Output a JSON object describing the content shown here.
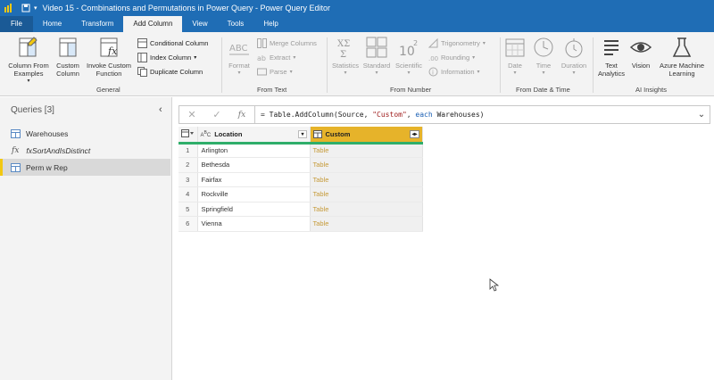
{
  "window": {
    "title": "Video 15 - Combinations and Permutations in Power Query - Power Query Editor"
  },
  "tabs": [
    {
      "label": "File"
    },
    {
      "label": "Home"
    },
    {
      "label": "Transform"
    },
    {
      "label": "Add Column"
    },
    {
      "label": "View"
    },
    {
      "label": "Tools"
    },
    {
      "label": "Help"
    }
  ],
  "ribbon": {
    "general": {
      "column_from_examples": "Column From Examples",
      "custom_column": "Custom Column",
      "invoke_custom_function": "Invoke Custom Function",
      "conditional_column": "Conditional Column",
      "index_column": "Index Column",
      "duplicate_column": "Duplicate Column",
      "group_label": "General"
    },
    "from_text": {
      "format": "Format",
      "merge_columns": "Merge Columns",
      "extract": "Extract",
      "parse": "Parse",
      "group_label": "From Text"
    },
    "from_number": {
      "statistics": "Statistics",
      "standard": "Standard",
      "scientific": "Scientific",
      "trigonometry": "Trigonometry",
      "rounding": "Rounding",
      "information": "Information",
      "group_label": "From Number"
    },
    "from_datetime": {
      "date": "Date",
      "time": "Time",
      "duration": "Duration",
      "group_label": "From Date & Time"
    },
    "ai": {
      "text_analytics": "Text Analytics",
      "vision": "Vision",
      "azure_ml": "Azure Machine Learning",
      "group_label": "AI Insights"
    }
  },
  "queries": {
    "title": "Queries [3]",
    "items": [
      {
        "name": "Warehouses",
        "icon": "table-icon"
      },
      {
        "name": "fxSortAndIsDistinct",
        "icon": "function-icon"
      },
      {
        "name": "Perm w Rep",
        "icon": "table-icon",
        "selected": true
      }
    ]
  },
  "formula": {
    "prefix": "= Table.AddColumn(Source, ",
    "string": "\"Custom\"",
    "mid": ", ",
    "keyword": "each",
    "suffix": " Warehouses)"
  },
  "table": {
    "columns": [
      {
        "name": "Location",
        "type": "ABC"
      },
      {
        "name": "Custom",
        "type": "table"
      }
    ],
    "rows": [
      {
        "n": "1",
        "location": "Arlington",
        "custom": "Table"
      },
      {
        "n": "2",
        "location": "Bethesda",
        "custom": "Table"
      },
      {
        "n": "3",
        "location": "Fairfax",
        "custom": "Table"
      },
      {
        "n": "4",
        "location": "Rockville",
        "custom": "Table"
      },
      {
        "n": "5",
        "location": "Springfield",
        "custom": "Table"
      },
      {
        "n": "6",
        "location": "Vienna",
        "custom": "Table"
      }
    ]
  }
}
